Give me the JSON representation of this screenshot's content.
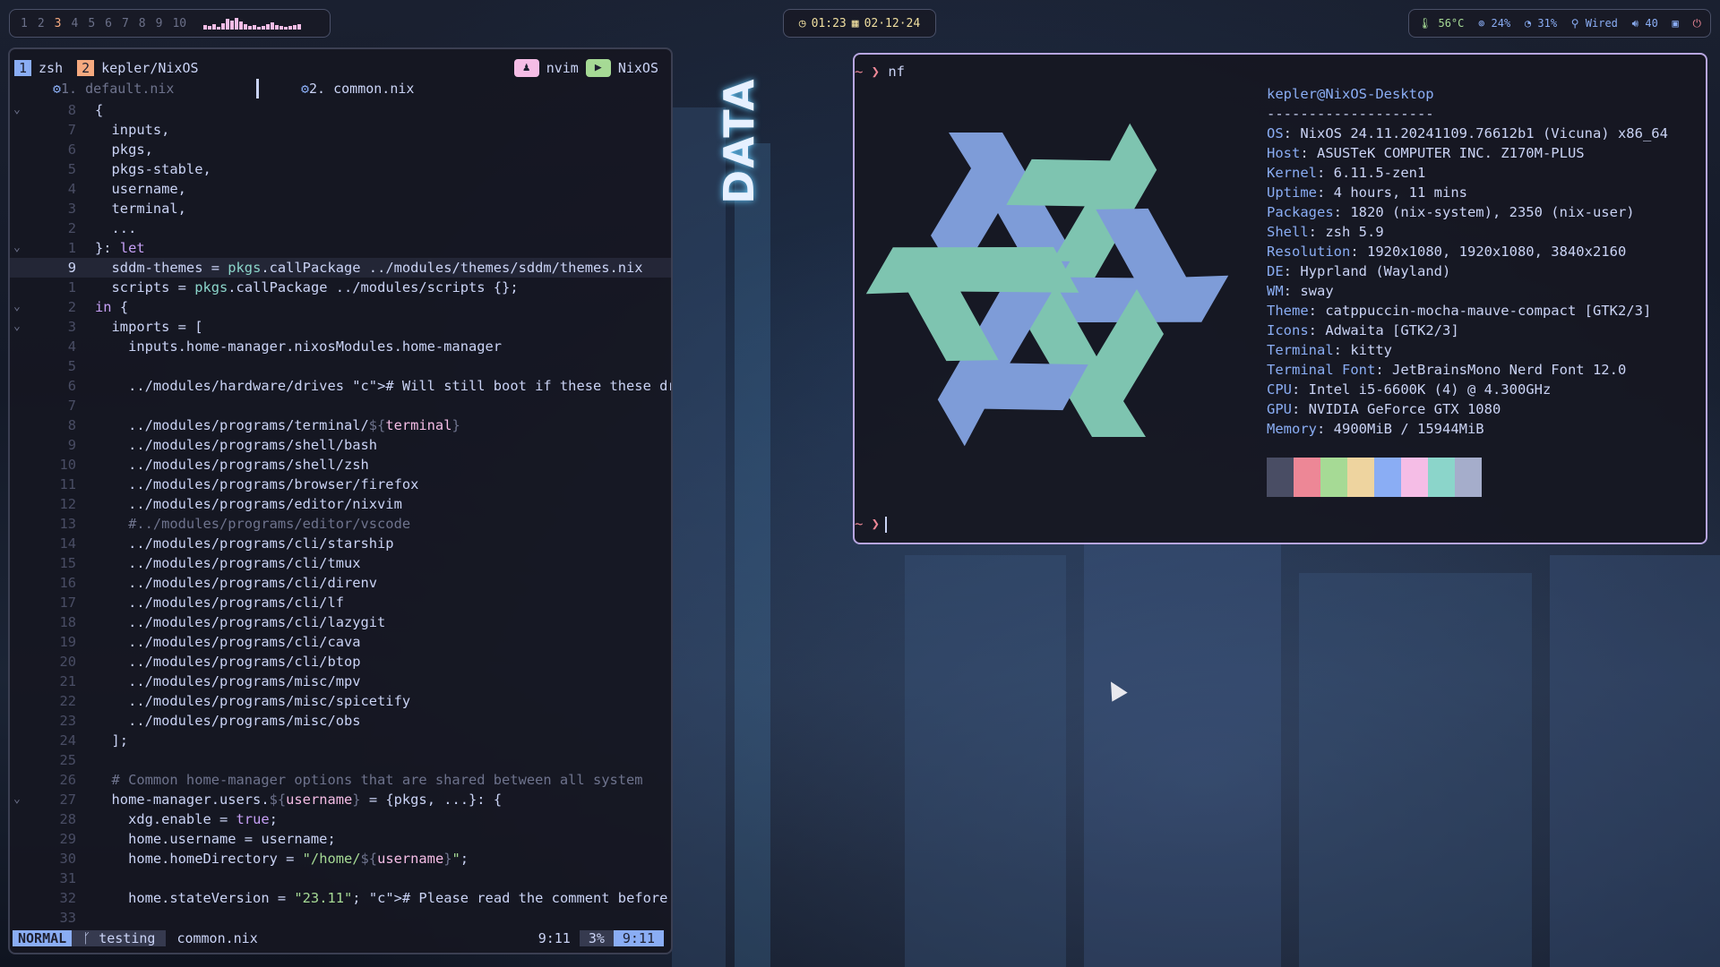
{
  "topbar": {
    "workspaces": [
      "1",
      "2",
      "3",
      "4",
      "5",
      "6",
      "7",
      "8",
      "9",
      "10"
    ],
    "active_workspace": "3",
    "clock": {
      "time": "01:23",
      "date": "02·12·24"
    },
    "stats": {
      "temp": "56°C",
      "cpu": "24%",
      "mem": "31%",
      "network": "Wired",
      "volume": "40"
    }
  },
  "nvim": {
    "tabs": [
      {
        "num": "1",
        "label": "zsh"
      },
      {
        "num": "2",
        "label": "kepler/NixOS"
      }
    ],
    "right_labels": [
      "nvim",
      "NixOS"
    ],
    "buffers": [
      "1. default.nix",
      "2. common.nix"
    ],
    "lines": [
      {
        "fold": "⌄",
        "num": "8",
        "text": "{"
      },
      {
        "fold": "",
        "num": "7",
        "text": "  inputs,"
      },
      {
        "fold": "",
        "num": "6",
        "text": "  pkgs,"
      },
      {
        "fold": "",
        "num": "5",
        "text": "  pkgs-stable,"
      },
      {
        "fold": "",
        "num": "4",
        "text": "  username,"
      },
      {
        "fold": "",
        "num": "3",
        "text": "  terminal,"
      },
      {
        "fold": "",
        "num": "2",
        "text": "  ..."
      },
      {
        "fold": "⌄",
        "num": "1",
        "text": "}: let"
      },
      {
        "fold": "",
        "num": "9",
        "text": "  sddm-themes = pkgs.callPackage ../modules/themes/sddm/themes.nix",
        "current": true
      },
      {
        "fold": "",
        "num": "1",
        "text": "  scripts = pkgs.callPackage ../modules/scripts {};"
      },
      {
        "fold": "⌄",
        "num": "2",
        "text": "in {"
      },
      {
        "fold": "⌄",
        "num": "3",
        "text": "  imports = ["
      },
      {
        "fold": "",
        "num": "4",
        "text": "    inputs.home-manager.nixosModules.home-manager"
      },
      {
        "fold": "",
        "num": "5",
        "text": ""
      },
      {
        "fold": "",
        "num": "6",
        "text": "    ../modules/hardware/drives # Will still boot if these these dr"
      },
      {
        "fold": "",
        "num": "7",
        "text": ""
      },
      {
        "fold": "",
        "num": "8",
        "text": "    ../modules/programs/terminal/${terminal}"
      },
      {
        "fold": "",
        "num": "9",
        "text": "    ../modules/programs/shell/bash"
      },
      {
        "fold": "",
        "num": "10",
        "text": "    ../modules/programs/shell/zsh"
      },
      {
        "fold": "",
        "num": "11",
        "text": "    ../modules/programs/browser/firefox"
      },
      {
        "fold": "",
        "num": "12",
        "text": "    ../modules/programs/editor/nixvim"
      },
      {
        "fold": "",
        "num": "13",
        "text": "    #../modules/programs/editor/vscode"
      },
      {
        "fold": "",
        "num": "14",
        "text": "    ../modules/programs/cli/starship"
      },
      {
        "fold": "",
        "num": "15",
        "text": "    ../modules/programs/cli/tmux"
      },
      {
        "fold": "",
        "num": "16",
        "text": "    ../modules/programs/cli/direnv"
      },
      {
        "fold": "",
        "num": "17",
        "text": "    ../modules/programs/cli/lf"
      },
      {
        "fold": "",
        "num": "18",
        "text": "    ../modules/programs/cli/lazygit"
      },
      {
        "fold": "",
        "num": "19",
        "text": "    ../modules/programs/cli/cava"
      },
      {
        "fold": "",
        "num": "20",
        "text": "    ../modules/programs/cli/btop"
      },
      {
        "fold": "",
        "num": "21",
        "text": "    ../modules/programs/misc/mpv"
      },
      {
        "fold": "",
        "num": "22",
        "text": "    ../modules/programs/misc/spicetify"
      },
      {
        "fold": "",
        "num": "23",
        "text": "    ../modules/programs/misc/obs"
      },
      {
        "fold": "",
        "num": "24",
        "text": "  ];"
      },
      {
        "fold": "",
        "num": "25",
        "text": ""
      },
      {
        "fold": "",
        "num": "26",
        "text": "  # Common home-manager options that are shared between all system"
      },
      {
        "fold": "⌄",
        "num": "27",
        "text": "  home-manager.users.${username} = {pkgs, ...}: {"
      },
      {
        "fold": "",
        "num": "28",
        "text": "    xdg.enable = true;"
      },
      {
        "fold": "",
        "num": "29",
        "text": "    home.username = username;"
      },
      {
        "fold": "",
        "num": "30",
        "text": "    home.homeDirectory = \"/home/${username}\";"
      },
      {
        "fold": "",
        "num": "31",
        "text": ""
      },
      {
        "fold": "",
        "num": "32",
        "text": "    home.stateVersion = \"23.11\"; # Please read the comment before"
      },
      {
        "fold": "",
        "num": "33",
        "text": ""
      }
    ],
    "status": {
      "mode": "NORMAL",
      "branch": "testing",
      "file": "common.nix",
      "position": "9:11",
      "percent": "3%",
      "position_right": "9:11"
    }
  },
  "terminal": {
    "command_prompt": "~ ❯",
    "command": "nf",
    "title": "kepler@NixOS-Desktop",
    "separator": "--------------------",
    "info": [
      {
        "key": "OS",
        "value": "NixOS 24.11.20241109.76612b1 (Vicuna) x86_64"
      },
      {
        "key": "Host",
        "value": "ASUSTeK COMPUTER INC. Z170M-PLUS"
      },
      {
        "key": "Kernel",
        "value": "6.11.5-zen1"
      },
      {
        "key": "Uptime",
        "value": "4 hours, 11 mins"
      },
      {
        "key": "Packages",
        "value": "1820 (nix-system), 2350 (nix-user)"
      },
      {
        "key": "Shell",
        "value": "zsh 5.9"
      },
      {
        "key": "Resolution",
        "value": "1920x1080, 1920x1080, 3840x2160"
      },
      {
        "key": "DE",
        "value": "Hyprland (Wayland)"
      },
      {
        "key": "WM",
        "value": "sway"
      },
      {
        "key": "Theme",
        "value": "catppuccin-mocha-mauve-compact [GTK2/3]"
      },
      {
        "key": "Icons",
        "value": "Adwaita [GTK2/3]"
      },
      {
        "key": "Terminal",
        "value": "kitty"
      },
      {
        "key": "Terminal Font",
        "value": "JetBrainsMono Nerd Font 12.0"
      },
      {
        "key": "CPU",
        "value": "Intel i5-6600K (4) @ 4.300GHz"
      },
      {
        "key": "GPU",
        "value": "NVIDIA GeForce GTX 1080"
      },
      {
        "key": "Memory",
        "value": "4900MiB / 15944MiB"
      }
    ],
    "swatch_colors": [
      "#494d64",
      "#ed8796",
      "#a6da95",
      "#eed49f",
      "#8aadf4",
      "#f5bde6",
      "#8bd5ca",
      "#a5adcb"
    ],
    "logo_colors": {
      "blue": "#7e9cd8",
      "teal": "#7ec4b0"
    }
  },
  "wallpaper": {
    "sign_text": "DATA"
  }
}
